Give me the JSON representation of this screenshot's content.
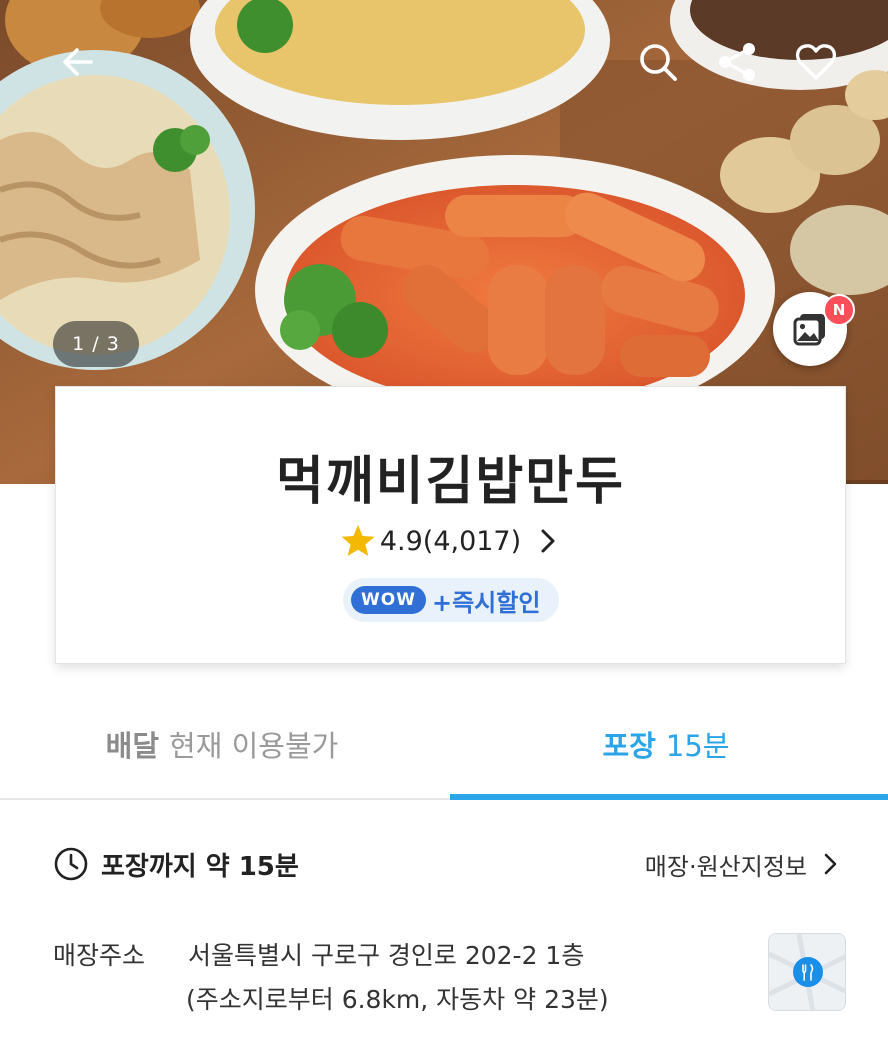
{
  "hero": {
    "counter": "1 / 3",
    "new_badge": "N"
  },
  "store": {
    "name": "먹깨비김밥만두",
    "rating": "4.9(4,017)",
    "wow_label": "WOW",
    "wow_text": "+즉시할인"
  },
  "tabs": [
    {
      "label": "배달",
      "sub": "현재 이용불가",
      "active": false
    },
    {
      "label": "포장",
      "sub": "15분",
      "active": true
    }
  ],
  "pickup": {
    "title": "포장까지 약 15분",
    "store_info_link": "매장·원산지정보",
    "address_label": "매장주소",
    "address_line1": "서울특별시 구로구 경인로 202-2 1층",
    "address_line2": "(주소지로부터 6.8km, 자동차 약 23분)"
  },
  "colors": {
    "accent": "#2ba4e8",
    "wow_blue": "#2f6fd6",
    "badge_red": "#ff4d5a",
    "star": "#f5b800"
  },
  "icons": [
    "back-arrow-icon",
    "search-icon",
    "share-icon",
    "heart-icon",
    "gallery-icon",
    "star-icon",
    "chevron-right-icon",
    "clock-icon",
    "map-pin-icon"
  ]
}
